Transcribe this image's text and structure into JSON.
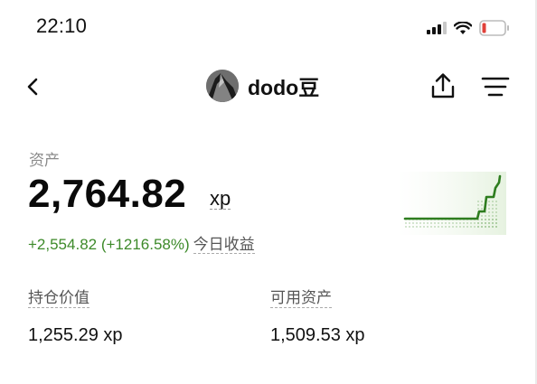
{
  "status_bar": {
    "time": "22:10",
    "icons": [
      "cellular-signal-icon",
      "wifi-icon",
      "battery-low-icon"
    ]
  },
  "nav": {
    "back_icon": "chevron-left-icon",
    "username": "dodo豆",
    "share_icon": "share-icon",
    "menu_icon": "menu-icon"
  },
  "account": {
    "assets_label": "资产",
    "total_value": "2,764.82",
    "unit": "xp",
    "change_value": "+2,554.82 (+1216.58%)",
    "change_period": "今日收益",
    "holding_label": "持仓价值",
    "holding_value": "1,255.29 xp",
    "available_label": "可用资产",
    "available_value": "1,509.53 xp"
  },
  "colors": {
    "positive": "#3d8a2a",
    "chart_line": "#2e7d1f",
    "battery_low": "#e0413a"
  }
}
